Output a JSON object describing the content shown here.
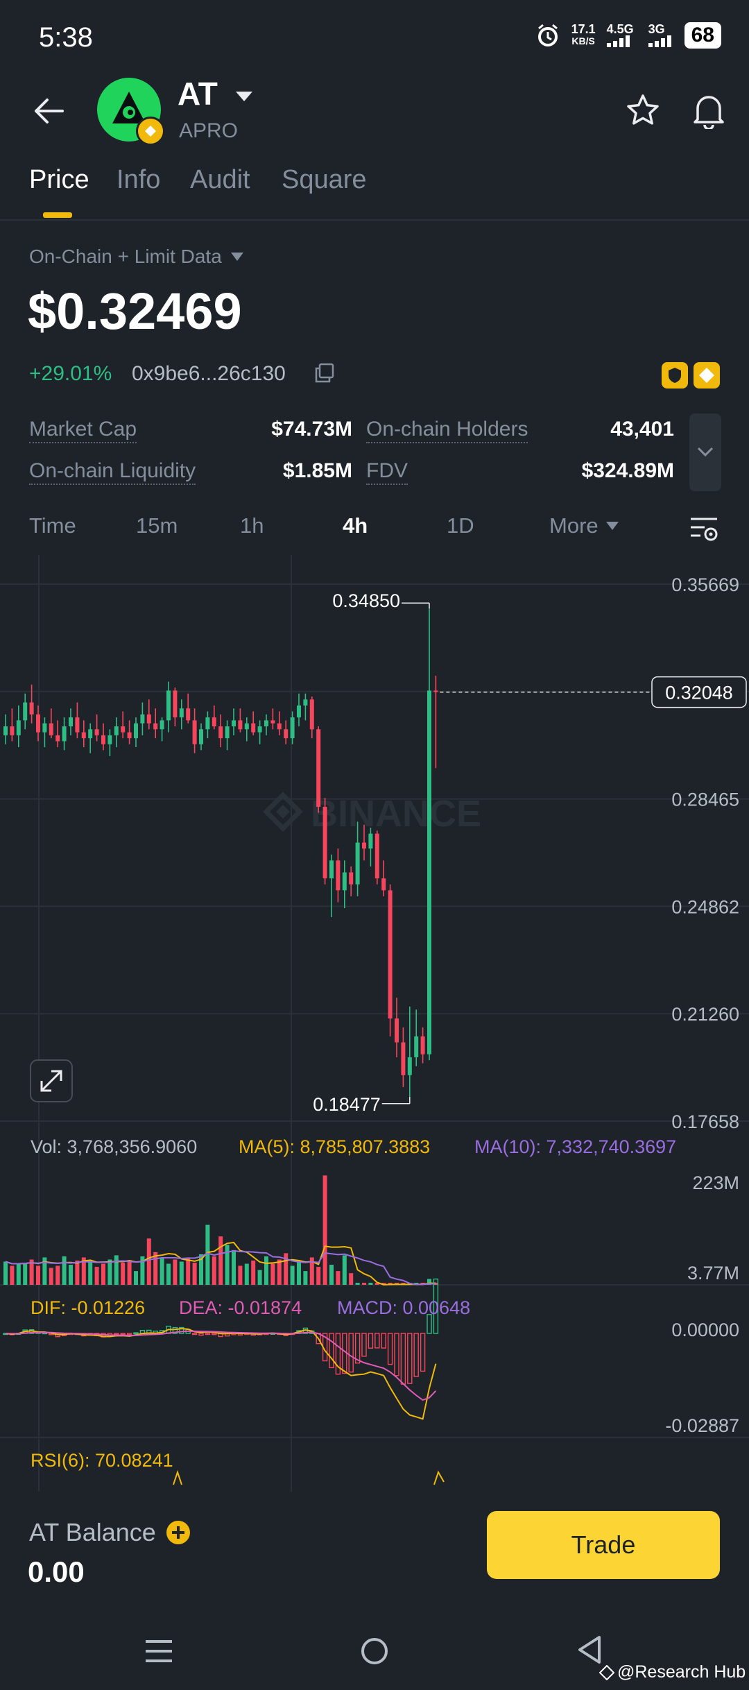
{
  "status": {
    "time": "5:38",
    "net_speed": "17.1",
    "net_unit": "KB/S",
    "sig1": "4.5G",
    "sig2": "3G",
    "battery": "68"
  },
  "header": {
    "symbol": "AT",
    "name": "APRO"
  },
  "tabs": [
    "Price",
    "Info",
    "Audit",
    "Square"
  ],
  "data_source": "On-Chain + Limit Data",
  "price": "$0.32469",
  "change": "+29.01%",
  "contract": "0x9be6...26c130",
  "stats": {
    "market_cap_label": "Market Cap",
    "market_cap": "$74.73M",
    "holders_label": "On-chain Holders",
    "holders": "43,401",
    "liquidity_label": "On-chain Liquidity",
    "liquidity": "$1.85M",
    "fdv_label": "FDV",
    "fdv": "$324.89M"
  },
  "timeframes": [
    "Time",
    "15m",
    "1h",
    "4h",
    "1D",
    "More"
  ],
  "active_timeframe": "4h",
  "watermark": "BINANCE",
  "chart": {
    "y_ticks": [
      "0.35669",
      "0.32067",
      "0.28465",
      "0.24862",
      "0.21260",
      "0.17658"
    ],
    "high_label": "0.34850",
    "low_label": "0.18477",
    "current_label": "0.32048",
    "vol_label": "Vol: 3,768,356.9060",
    "ma5_label": "MA(5): 8,785,807.3883",
    "ma10_label": "MA(10): 7,332,740.3697",
    "vol_max": "223M",
    "vol_min": "3.77M",
    "dif_label": "DIF: -0.01226",
    "dea_label": "DEA: -0.01874",
    "macd_label": "MACD: 0.00648",
    "macd_top": "0.00000",
    "macd_bottom": "-0.02887",
    "rsi_label": "RSI(6): 70.08241"
  },
  "chart_data": {
    "type": "candlestick",
    "interval": "4h",
    "ylim": [
      0.17658,
      0.35669
    ],
    "high": 0.3485,
    "low": 0.18477,
    "last": 0.32048,
    "candles": [
      [
        0.306,
        0.313,
        0.303,
        0.309
      ],
      [
        0.309,
        0.315,
        0.304,
        0.306
      ],
      [
        0.306,
        0.316,
        0.302,
        0.311
      ],
      [
        0.311,
        0.32,
        0.308,
        0.317
      ],
      [
        0.317,
        0.323,
        0.31,
        0.313
      ],
      [
        0.313,
        0.316,
        0.304,
        0.307
      ],
      [
        0.307,
        0.312,
        0.302,
        0.31
      ],
      [
        0.31,
        0.315,
        0.305,
        0.306
      ],
      [
        0.306,
        0.311,
        0.302,
        0.304
      ],
      [
        0.304,
        0.312,
        0.301,
        0.309
      ],
      [
        0.309,
        0.315,
        0.306,
        0.312
      ],
      [
        0.312,
        0.317,
        0.305,
        0.307
      ],
      [
        0.307,
        0.311,
        0.302,
        0.305
      ],
      [
        0.305,
        0.31,
        0.3,
        0.308
      ],
      [
        0.308,
        0.313,
        0.304,
        0.306
      ],
      [
        0.306,
        0.31,
        0.301,
        0.303
      ],
      [
        0.303,
        0.308,
        0.299,
        0.306
      ],
      [
        0.306,
        0.312,
        0.302,
        0.309
      ],
      [
        0.309,
        0.314,
        0.305,
        0.307
      ],
      [
        0.307,
        0.311,
        0.303,
        0.305
      ],
      [
        0.305,
        0.312,
        0.302,
        0.31
      ],
      [
        0.31,
        0.317,
        0.306,
        0.313
      ],
      [
        0.313,
        0.318,
        0.308,
        0.31
      ],
      [
        0.31,
        0.315,
        0.305,
        0.308
      ],
      [
        0.308,
        0.312,
        0.304,
        0.311
      ],
      [
        0.311,
        0.324,
        0.307,
        0.321
      ],
      [
        0.321,
        0.322,
        0.309,
        0.312
      ],
      [
        0.312,
        0.318,
        0.308,
        0.315
      ],
      [
        0.315,
        0.32,
        0.31,
        0.311
      ],
      [
        0.311,
        0.315,
        0.3,
        0.303
      ],
      [
        0.303,
        0.31,
        0.301,
        0.308
      ],
      [
        0.308,
        0.314,
        0.305,
        0.312
      ],
      [
        0.312,
        0.316,
        0.308,
        0.309
      ],
      [
        0.309,
        0.313,
        0.302,
        0.305
      ],
      [
        0.305,
        0.311,
        0.301,
        0.309
      ],
      [
        0.309,
        0.315,
        0.306,
        0.311
      ],
      [
        0.311,
        0.315,
        0.307,
        0.308
      ],
      [
        0.308,
        0.312,
        0.304,
        0.31
      ],
      [
        0.31,
        0.314,
        0.306,
        0.307
      ],
      [
        0.307,
        0.311,
        0.303,
        0.309
      ],
      [
        0.309,
        0.313,
        0.306,
        0.311
      ],
      [
        0.311,
        0.315,
        0.308,
        0.31
      ],
      [
        0.31,
        0.314,
        0.306,
        0.308
      ],
      [
        0.308,
        0.311,
        0.303,
        0.305
      ],
      [
        0.305,
        0.314,
        0.303,
        0.312
      ],
      [
        0.312,
        0.32,
        0.309,
        0.316
      ],
      [
        0.316,
        0.32,
        0.311,
        0.318
      ],
      [
        0.318,
        0.319,
        0.305,
        0.308
      ],
      [
        0.308,
        0.309,
        0.28,
        0.282
      ],
      [
        0.282,
        0.285,
        0.256,
        0.258
      ],
      [
        0.258,
        0.266,
        0.245,
        0.264
      ],
      [
        0.264,
        0.268,
        0.25,
        0.254
      ],
      [
        0.254,
        0.264,
        0.248,
        0.26
      ],
      [
        0.26,
        0.262,
        0.252,
        0.256
      ],
      [
        0.256,
        0.277,
        0.252,
        0.27
      ],
      [
        0.27,
        0.276,
        0.264,
        0.268
      ],
      [
        0.268,
        0.275,
        0.262,
        0.273
      ],
      [
        0.273,
        0.274,
        0.256,
        0.258
      ],
      [
        0.258,
        0.264,
        0.252,
        0.254
      ],
      [
        0.254,
        0.256,
        0.205,
        0.211
      ],
      [
        0.211,
        0.218,
        0.198,
        0.203
      ],
      [
        0.203,
        0.208,
        0.188,
        0.192
      ],
      [
        0.192,
        0.215,
        0.1848,
        0.198
      ],
      [
        0.198,
        0.214,
        0.195,
        0.205
      ],
      [
        0.205,
        0.208,
        0.196,
        0.199
      ],
      [
        0.199,
        0.3485,
        0.197,
        0.321
      ],
      [
        0.321,
        0.326,
        0.295,
        0.3205
      ]
    ],
    "volume": [
      48,
      40,
      44,
      46,
      52,
      40,
      56,
      36,
      40,
      58,
      42,
      50,
      56,
      48,
      38,
      44,
      52,
      60,
      46,
      48,
      30,
      58,
      92,
      66,
      56,
      44,
      52,
      48,
      54,
      46,
      62,
      118,
      58,
      96,
      80,
      70,
      40,
      44,
      50,
      32,
      58,
      44,
      52,
      64,
      40,
      50,
      30,
      56,
      38,
      212,
      42,
      30,
      60,
      26,
      4,
      4,
      4,
      4,
      4,
      6,
      5,
      4,
      4,
      5,
      6,
      15,
      5
    ],
    "volume_ylim": [
      3.77,
      223
    ],
    "indicators": {
      "DIF": -0.01226,
      "DEA": -0.01874,
      "MACD": 0.00648,
      "RSI6": 70.08241,
      "Vol": 3768356.906,
      "MA5": 8785807.3883,
      "MA10": 7332740.3697
    }
  },
  "balance": {
    "label": "AT Balance",
    "value": "0.00"
  },
  "trade_label": "Trade",
  "credit": "@Research Hub",
  "colors": {
    "up": "#2ebd85",
    "down": "#f6465d",
    "accent": "#fcd535",
    "bg": "#1e2329",
    "dif": "#f0b90b",
    "dea": "#e05cb5",
    "macd": "#9a6ee0"
  }
}
